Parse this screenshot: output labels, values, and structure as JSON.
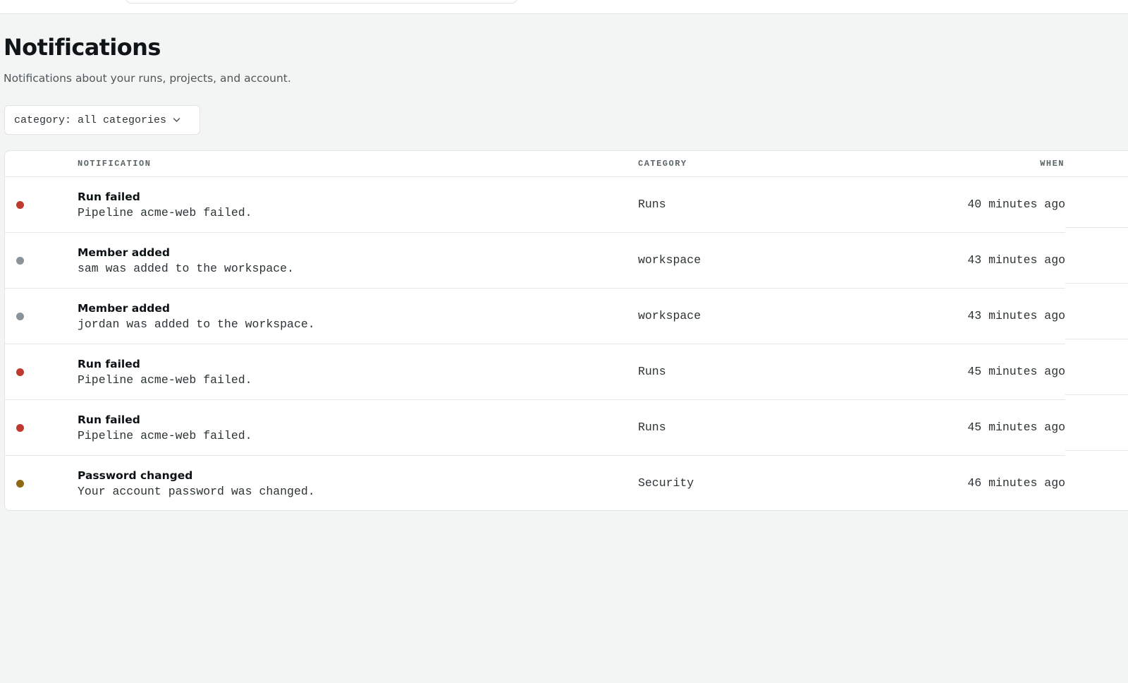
{
  "page": {
    "title": "Notifications",
    "subtitle": "Notifications about your runs, projects, and account."
  },
  "filter": {
    "label": "category: all categories",
    "icon": "chevron-down-icon"
  },
  "table": {
    "columns": {
      "notification": "NOTIFICATION",
      "category": "CATEGORY",
      "when": "WHEN"
    },
    "rows": [
      {
        "title": "Run failed",
        "description": "Pipeline acme-web failed.",
        "category": "Runs",
        "when": "40 minutes ago",
        "status_color": "#c0392f"
      },
      {
        "title": "Member added",
        "description": "sam was added to the workspace.",
        "category": "workspace",
        "when": "43 minutes ago",
        "status_color": "#8a929a"
      },
      {
        "title": "Member added",
        "description": "jordan was added to the workspace.",
        "category": "workspace",
        "when": "43 minutes ago",
        "status_color": "#8a929a"
      },
      {
        "title": "Run failed",
        "description": "Pipeline acme-web failed.",
        "category": "Runs",
        "when": "45 minutes ago",
        "status_color": "#c0392f"
      },
      {
        "title": "Run failed",
        "description": "Pipeline acme-web failed.",
        "category": "Runs",
        "when": "45 minutes ago",
        "status_color": "#c0392f"
      },
      {
        "title": "Password changed",
        "description": "Your account password was changed.",
        "category": "Security",
        "when": "46 minutes ago",
        "status_color": "#8f6914"
      }
    ]
  }
}
